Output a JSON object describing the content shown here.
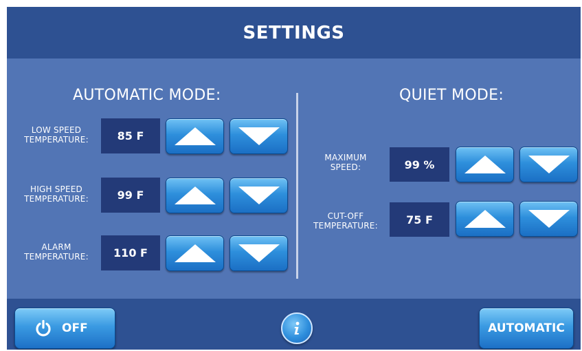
{
  "header": {
    "title": "SETTINGS"
  },
  "automatic_mode": {
    "title": "AUTOMATIC MODE:",
    "rows": [
      {
        "label_line1": "LOW SPEED",
        "label_line2": "TEMPERATURE:",
        "value": "85 F"
      },
      {
        "label_line1": "HIGH SPEED",
        "label_line2": "TEMPERATURE:",
        "value": "99 F"
      },
      {
        "label_line1": "ALARM",
        "label_line2": "TEMPERATURE:",
        "value": "110 F"
      }
    ]
  },
  "quiet_mode": {
    "title": "QUIET MODE:",
    "rows": [
      {
        "label_line1": "MAXIMUM",
        "label_line2": "SPEED:",
        "value": "99 %"
      },
      {
        "label_line1": "CUT-OFF",
        "label_line2": "TEMPERATURE:",
        "value": "75 F"
      }
    ]
  },
  "footer": {
    "power_label": "OFF",
    "info_icon": "info-icon",
    "mode_label": "AUTOMATIC"
  },
  "colors": {
    "background": "#5275b5",
    "bar": "#2e5192",
    "value_box": "#233a78",
    "button_blue": "#2e8fdc"
  }
}
